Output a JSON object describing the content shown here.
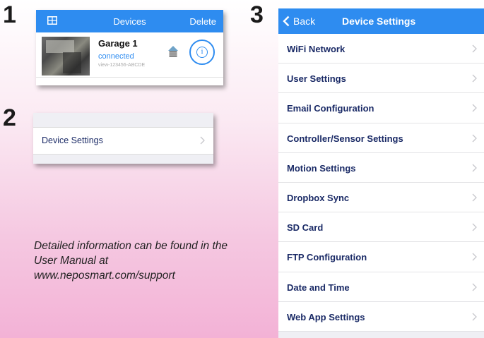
{
  "steps": {
    "one": "1",
    "two": "2",
    "three": "3"
  },
  "devices_screen": {
    "title": "Devices",
    "delete_label": "Delete",
    "device": {
      "name": "Garage 1",
      "status": "connected",
      "id": "view-123456-ABCDE"
    },
    "icons": [
      "grid-icon",
      "house-icon",
      "info-icon"
    ]
  },
  "settings_entry": {
    "label": "Device Settings"
  },
  "note": "Detailed information can be found in the User Manual at www.neposmart.com/support",
  "device_settings_screen": {
    "back_label": "Back",
    "title": "Device Settings",
    "items": [
      {
        "label": "WiFi Network"
      },
      {
        "label": "User Settings"
      },
      {
        "label": "Email Configuration"
      },
      {
        "label": "Controller/Sensor Settings"
      },
      {
        "label": "Motion Settings"
      },
      {
        "label": "Dropbox Sync"
      },
      {
        "label": "SD Card"
      },
      {
        "label": "FTP Configuration"
      },
      {
        "label": "Date and Time"
      },
      {
        "label": "Web App Settings"
      }
    ]
  },
  "colors": {
    "accent": "#2e8cf0",
    "label_text": "#1a2a66"
  }
}
